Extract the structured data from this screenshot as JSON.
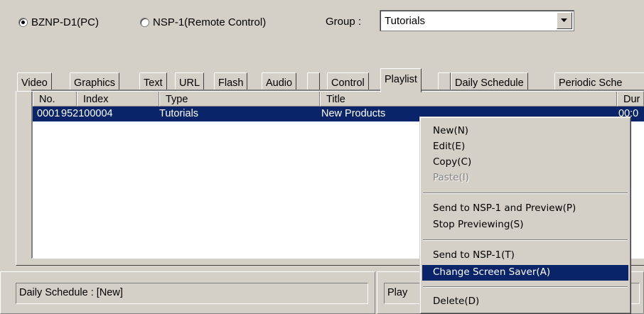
{
  "target": {
    "options": [
      {
        "label": "BZNP-D1(PC)",
        "checked": true
      },
      {
        "label": "NSP-1(Remote Control)",
        "checked": false
      }
    ]
  },
  "group": {
    "label": "Group :",
    "value": "Tutorials"
  },
  "tabs": [
    "Video",
    "Graphics",
    "Text",
    "URL",
    "Flash",
    "Audio",
    "Control",
    "Playlist",
    "Daily Schedule",
    "Periodic Sche"
  ],
  "active_tab": "Playlist",
  "list": {
    "columns": [
      "No.",
      "Index",
      "Type",
      "Title",
      "Dur"
    ],
    "rows": [
      {
        "no": "0001",
        "index": "952100004",
        "type": "Tutorials",
        "title": "New Products",
        "dur": "00:0"
      }
    ]
  },
  "context_menu": {
    "items": [
      {
        "label": "New(N)",
        "enabled": true
      },
      {
        "label": "Edit(E)",
        "enabled": true
      },
      {
        "label": "Copy(C)",
        "enabled": true
      },
      {
        "label": "Paste(I)",
        "enabled": false
      },
      {
        "label": "Send to NSP-1 and Preview(P)",
        "enabled": true
      },
      {
        "label": "Stop Previewing(S)",
        "enabled": true
      },
      {
        "label": "Send to NSP-1(T)",
        "enabled": true
      },
      {
        "label": "Change Screen Saver(A)",
        "enabled": true,
        "highlighted": true
      },
      {
        "label": "Delete(D)",
        "enabled": true
      }
    ]
  },
  "status": {
    "daily_schedule": "Daily Schedule : [New]",
    "playlist": "Play"
  },
  "colors": {
    "face": "#d4d0c8",
    "highlight": "#0a246a",
    "window": "#ffffff"
  }
}
